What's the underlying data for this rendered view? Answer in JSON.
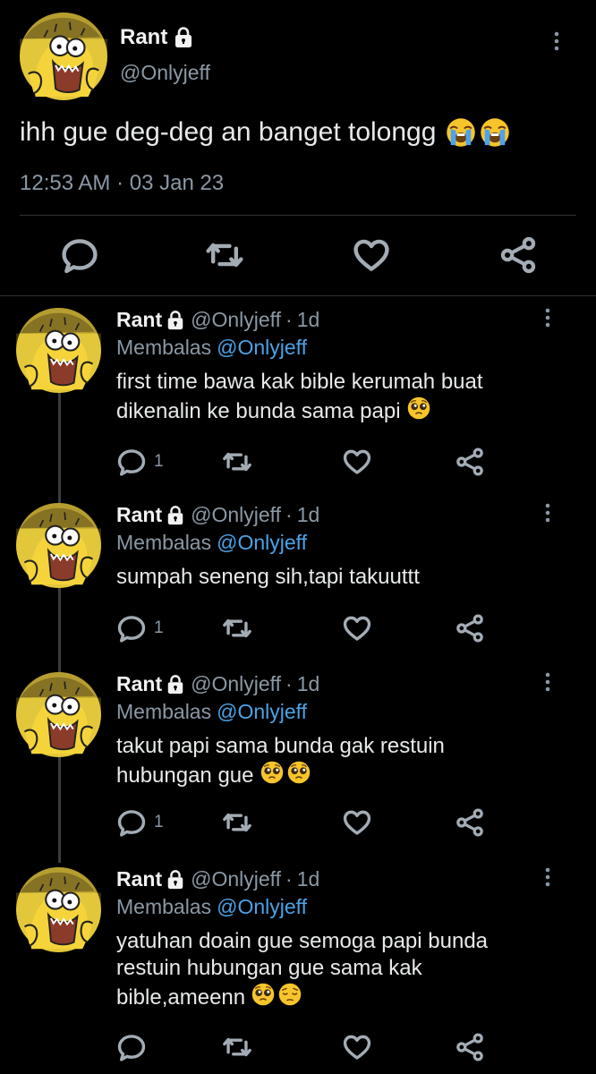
{
  "main_tweet": {
    "author_name": "Rant",
    "author_handle": "@Onlyjeff",
    "text": "ihh gue deg-deg an banget tolongg",
    "emojis": [
      "loudly-crying-face",
      "loudly-crying-face"
    ],
    "timestamp": "12:53 AM · 03 Jan 23"
  },
  "replies": [
    {
      "author_name": "Rant",
      "author_handle": "@Onlyjeff",
      "time": "1d",
      "replying_label": "Membalas",
      "replying_to": "@Onlyjeff",
      "text": "first time bawa kak bible kerumah buat dikenalin ke bunda sama papi",
      "emojis": [
        "pleading-face"
      ],
      "reply_count": "1"
    },
    {
      "author_name": "Rant",
      "author_handle": "@Onlyjeff",
      "time": "1d",
      "replying_label": "Membalas",
      "replying_to": "@Onlyjeff",
      "text": "sumpah seneng sih,tapi takuuttt",
      "emojis": [],
      "reply_count": "1"
    },
    {
      "author_name": "Rant",
      "author_handle": "@Onlyjeff",
      "time": "1d",
      "replying_label": "Membalas",
      "replying_to": "@Onlyjeff",
      "text": "takut papi sama bunda gak restuin hubungan gue",
      "emojis": [
        "pleading-face",
        "pleading-face"
      ],
      "reply_count": "1"
    },
    {
      "author_name": "Rant",
      "author_handle": "@Onlyjeff",
      "time": "1d",
      "replying_label": "Membalas",
      "replying_to": "@Onlyjeff",
      "text": "yatuhan doain gue semoga papi bunda restuin hubungan gue sama kak bible,ameenn",
      "emojis": [
        "pleading-face",
        "pensive-face"
      ],
      "reply_count": ""
    }
  ],
  "colors": {
    "background": "#000000",
    "text": "#e7e9ea",
    "secondary_text": "#8b98a5",
    "mention": "#4aa3e6",
    "divider": "#2f3336"
  },
  "icons": {
    "reply": "comment-icon",
    "retweet": "retweet-icon",
    "like": "heart-icon",
    "share": "share-icon",
    "more": "more-vertical-icon",
    "lock": "lock-icon"
  }
}
